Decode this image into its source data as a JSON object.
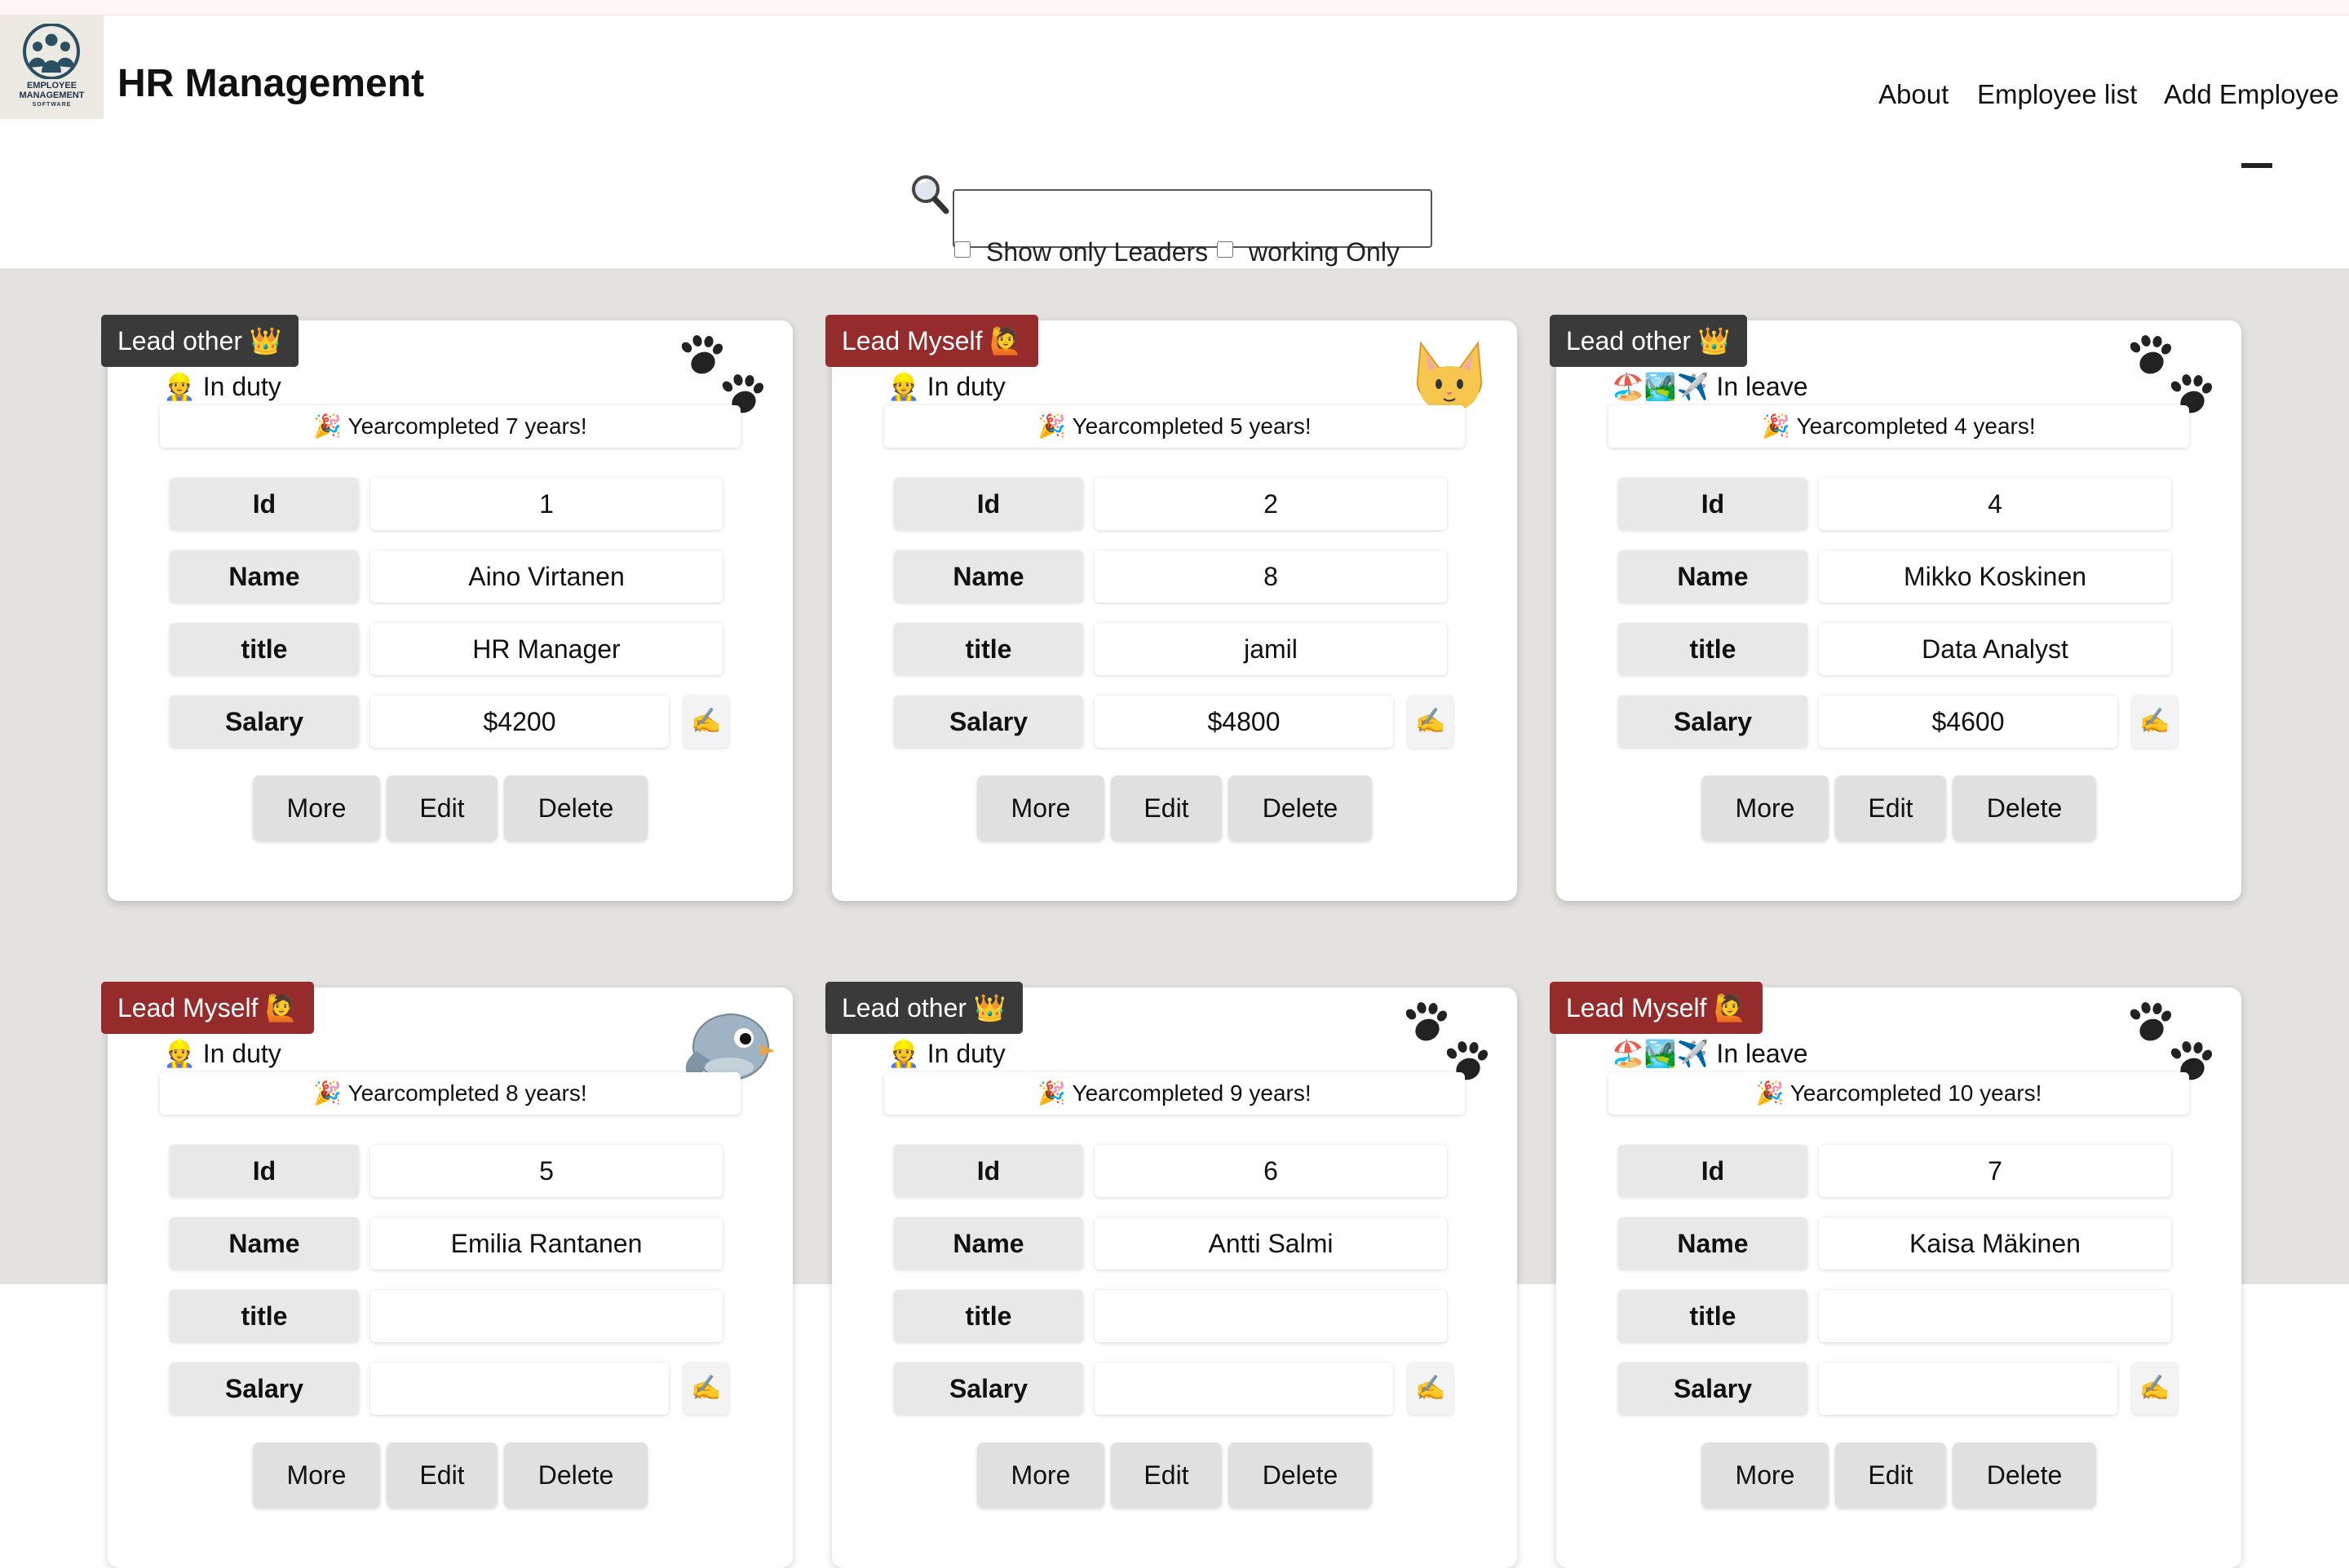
{
  "header": {
    "logo_text": [
      "EMPLOYEE",
      "MANAGEMENT",
      "SOFTWARE"
    ],
    "title": "HR Management",
    "nav": [
      "About",
      "Employee list",
      "Add Employee"
    ]
  },
  "search": {
    "value": "",
    "placeholder": "",
    "icon": "magnifier-icon",
    "filters": [
      {
        "label": "Show only Leaders",
        "checked": false
      },
      {
        "label": "working Only",
        "checked": false
      }
    ]
  },
  "field_labels": {
    "id": "Id",
    "name": "Name",
    "title": "title",
    "salary": "Salary"
  },
  "buttons": {
    "more": "More",
    "edit": "Edit",
    "delete": "Delete",
    "edit_salary": "✍️"
  },
  "employees": [
    {
      "badge": "Lead other 👑",
      "badge_type": "other",
      "pet": "paw",
      "status": "👷 In duty",
      "anniversary": "🎉 Yearcompleted 7 years!",
      "id": "1",
      "name": "Aino Virtanen",
      "title": "HR Manager",
      "salary": "$4200"
    },
    {
      "badge": "Lead Myself 🙋",
      "badge_type": "myself",
      "pet": "cat",
      "status": "👷 In duty",
      "anniversary": "🎉 Yearcompleted 5 years!",
      "id": "2",
      "name": "8",
      "title": "jamil",
      "salary": "$4800"
    },
    {
      "badge": "Lead other 👑",
      "badge_type": "other",
      "pet": "paw",
      "status": "🏖️🏞️✈️ In leave",
      "anniversary": "🎉 Yearcompleted 4 years!",
      "id": "4",
      "name": "Mikko Koskinen",
      "title": "Data Analyst",
      "salary": "$4600"
    },
    {
      "badge": "Lead Myself 🙋",
      "badge_type": "myself",
      "pet": "bird",
      "status": "👷 In duty",
      "anniversary": "🎉 Yearcompleted 8 years!",
      "id": "5",
      "name": "Emilia Rantanen",
      "title": "",
      "salary": ""
    },
    {
      "badge": "Lead other 👑",
      "badge_type": "other",
      "pet": "paw",
      "status": "👷 In duty",
      "anniversary": "🎉 Yearcompleted 9 years!",
      "id": "6",
      "name": "Antti Salmi",
      "title": "",
      "salary": ""
    },
    {
      "badge": "Lead Myself 🙋",
      "badge_type": "myself",
      "pet": "paw",
      "status": "🏖️🏞️✈️ In leave",
      "anniversary": "🎉 Yearcompleted 10 years!",
      "id": "7",
      "name": "Kaisa Mäkinen",
      "title": "",
      "salary": ""
    }
  ],
  "colors": {
    "lead_other": "#3a3a3a",
    "lead_myself": "#962b2b",
    "content_bg": "#e3e2df",
    "card_bg": "#ffffff"
  }
}
